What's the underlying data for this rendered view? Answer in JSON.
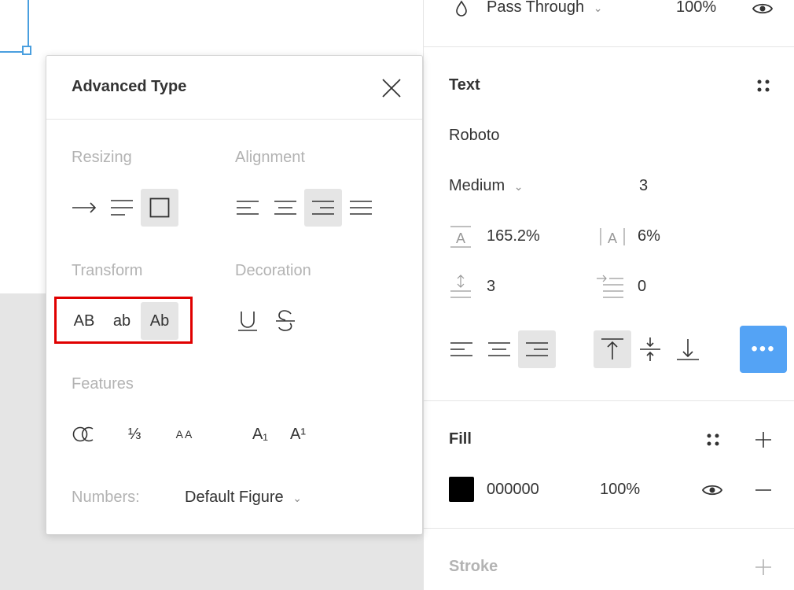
{
  "layer": {
    "blend_mode": "Pass Through",
    "opacity": "100%"
  },
  "text_section": {
    "title": "Text",
    "font_family": "Roboto",
    "font_weight": "Medium",
    "font_size": "3",
    "line_height": "165.2%",
    "letter_spacing": "6%",
    "paragraph_spacing": "3",
    "paragraph_indent": "0"
  },
  "fill_section": {
    "title": "Fill",
    "color_hex": "000000",
    "color": "#000000",
    "opacity": "100%"
  },
  "stroke_section": {
    "title": "Stroke"
  },
  "popup": {
    "title": "Advanced Type",
    "resizing_label": "Resizing",
    "alignment_label": "Alignment",
    "transform_label": "Transform",
    "decoration_label": "Decoration",
    "features_label": "Features",
    "transform_upper": "AB",
    "transform_lower": "ab",
    "transform_title": "Ab",
    "feature_fraction": "⅓",
    "feature_smallcaps": "AA",
    "feature_sub": "A₁",
    "feature_sup": "A¹",
    "numbers_label": "Numbers:",
    "numbers_value": "Default Figure"
  },
  "colors": {
    "accent": "#4a9fdf",
    "more_button": "#54a3f5",
    "highlight": "#e00000"
  }
}
